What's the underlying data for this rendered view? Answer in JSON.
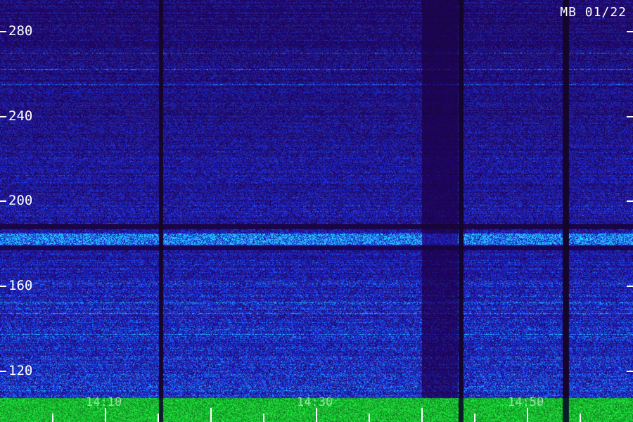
{
  "window": {
    "station_date_label": "MB 01/22"
  },
  "axis": {
    "y_ticks": [
      "280",
      "240",
      "200",
      "160",
      "120"
    ],
    "x_labels": [
      "14:10",
      "14:30",
      "14:50"
    ]
  },
  "colors": {
    "background": "#000000",
    "low": "#1a0a6e",
    "mid": "#2a3cff",
    "high": "#20e0ff",
    "peak": "#40ff40"
  }
}
